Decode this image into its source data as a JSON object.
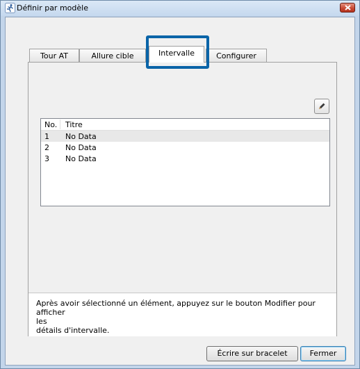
{
  "window": {
    "title": "Définir par modèle"
  },
  "tabs": [
    {
      "label": "Tour AT"
    },
    {
      "label": "Allure cible"
    },
    {
      "label": "Intervalle"
    },
    {
      "label": "Configurer"
    }
  ],
  "active_tab": "Intervalle",
  "list": {
    "headers": {
      "no": "No.",
      "titre": "Titre"
    },
    "rows": [
      {
        "no": "1",
        "titre": "No Data"
      },
      {
        "no": "2",
        "titre": "No Data"
      },
      {
        "no": "3",
        "titre": "No Data"
      }
    ]
  },
  "info": {
    "line1": "Après avoir sélectionné un élément, appuyez sur le bouton Modifier pour afficher",
    "line2": "les",
    "line3": "détails d'intervalle."
  },
  "buttons": {
    "write": "Écrire sur bracelet",
    "close": "Fermer"
  },
  "icons": {
    "app": "runner-icon",
    "edit": "pencil-icon",
    "close": "close-icon"
  }
}
